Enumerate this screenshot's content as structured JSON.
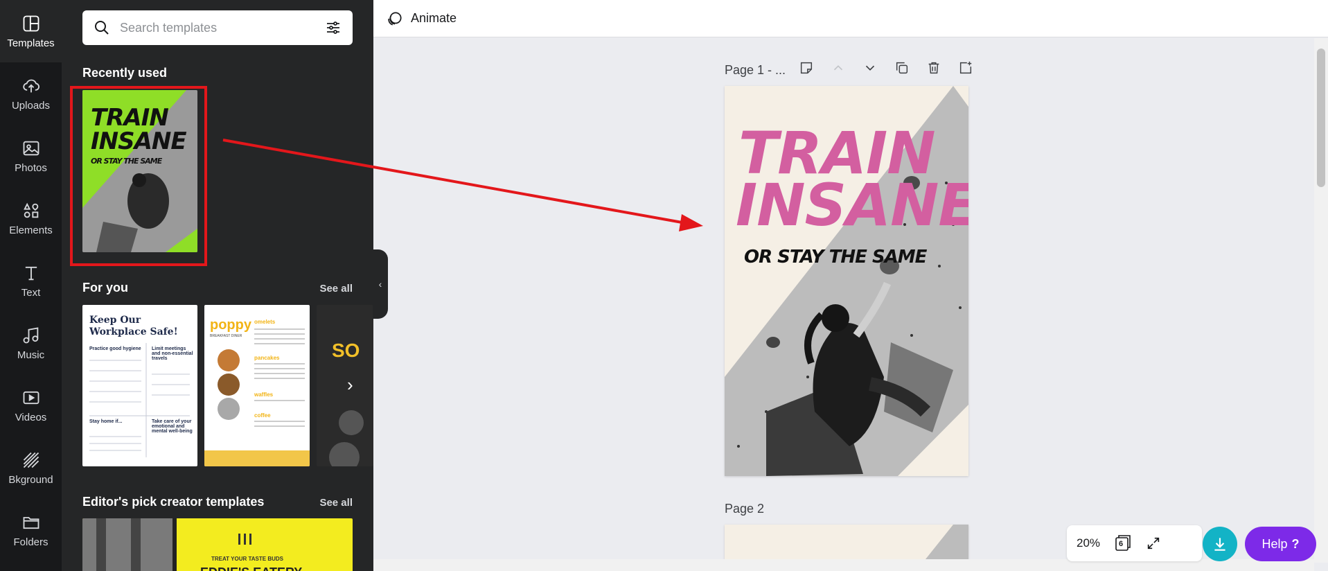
{
  "rail": {
    "items": [
      {
        "label": "Templates",
        "icon": "templates-icon"
      },
      {
        "label": "Uploads",
        "icon": "upload-icon"
      },
      {
        "label": "Photos",
        "icon": "photo-icon"
      },
      {
        "label": "Elements",
        "icon": "elements-icon"
      },
      {
        "label": "Text",
        "icon": "text-icon"
      },
      {
        "label": "Music",
        "icon": "music-icon"
      },
      {
        "label": "Videos",
        "icon": "video-icon"
      },
      {
        "label": "Bkground",
        "icon": "background-icon"
      },
      {
        "label": "Folders",
        "icon": "folder-icon"
      }
    ]
  },
  "panel": {
    "search_placeholder": "Search templates",
    "recently_used": "Recently used",
    "for_you": "For you",
    "see_all": "See all",
    "editors_pick": "Editor's pick creator templates",
    "recent_thumb": {
      "line1": "TRAIN",
      "line2": "INSANE",
      "line3": "OR STAY THE SAME"
    },
    "for_you_cards": [
      {
        "title": "Keep Our Workplace Safe!",
        "sub1": "Practice good hygiene",
        "sub2": "Limit meetings and non-essential travels",
        "sub3": "Stay home if...",
        "sub4": "Take care of your emotional and mental well-being"
      },
      {
        "title": "poppy",
        "sub1": "BREAKFAST DINER",
        "sub2": "omelets",
        "sub3": "pancakes",
        "sub4": "waffles",
        "sub5": "coffee"
      },
      {
        "title": "SO"
      }
    ],
    "editors_card": {
      "line1": "TREAT YOUR TASTE BUDS",
      "line2": "EDDIE'S EATERY"
    }
  },
  "topbar": {
    "animate": "Animate"
  },
  "canvas": {
    "page1_label": "Page 1 - ...",
    "page2_label": "Page 2",
    "poster": {
      "line1": "TRAIN",
      "line2": "INSANE",
      "line3": "OR STAY THE SAME"
    }
  },
  "footer": {
    "zoom": "20%",
    "page_count": "6",
    "help": "Help",
    "help_symbol": "?"
  },
  "colors": {
    "accent_purple": "#7d2ae8",
    "accent_teal": "#13b3c6",
    "poster_pink": "#d35fa0",
    "thumb_green": "#8fde27",
    "highlight_red": "#e3171b"
  }
}
